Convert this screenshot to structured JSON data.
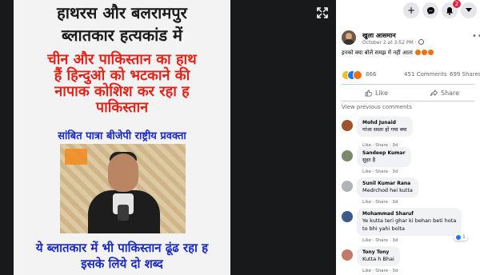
{
  "poster": {
    "title_line1": "हाथरस और बलरामपुर",
    "title_line2": "ब्लातकार हत्यकांड में",
    "red_line1": "चीन और पाकिस्तान का हाथ",
    "red_line2": "हैं हिन्दुओ को भटकाने की",
    "red_line3": "नापाक कोशिश कर रहा ह",
    "red_line4": "पाकिस्तान",
    "subtitle": "सांबित पात्रा बीजेपी राष्ट्रीय प्रवक्ता",
    "bottom_line1": "ये ब्लातकार में भी पाकिस्तान ढूंढ रहा ह",
    "bottom_line2": "इसके लिये दो शब्द"
  },
  "topbar": {
    "notification_count": "2"
  },
  "post": {
    "author": "खुला आसमान",
    "timestamp": "October 2 at 3:52 PM",
    "text": "इनको क्या बोलें समझ में नहीं आता",
    "reaction_count": "866",
    "comments_count": "451 Comments",
    "shares_count": "699 Shares",
    "like_label": "Like",
    "share_label": "Share",
    "view_previous": "View previous comments"
  },
  "comments": [
    {
      "name": "Mohd Junaid",
      "text": "गांजा सस्ता हो गया क्या",
      "meta": "Like · Share · 3d",
      "avatar_color": "#a0522d"
    },
    {
      "name": "Sandeep Kumar",
      "text": "सुहर है",
      "meta": "Like · Share · 3d",
      "avatar_color": "#7a8a6a"
    },
    {
      "name": "Sunil Kumar Rana",
      "text": "Medrchod hei kutta",
      "meta": "Like · Share · 3d",
      "avatar_color": "#b0b3b8"
    },
    {
      "name": "Mohammad Sharuf",
      "text": "Ye kutta teri ghar ki behan beti hota",
      "text2": "to bhi yahi bolta",
      "meta": "Like · Share · 3d",
      "avatar_color": "#3b5b8a",
      "likes": "1"
    },
    {
      "name": "Tony Tony",
      "text": "Kutta h Bhai",
      "meta": "Like · Share · 3d",
      "avatar_color": "#c07a6a"
    }
  ],
  "colors": {
    "accent_blue": "#1877f2",
    "red": "#e41e3f",
    "poster_red": "#e2231a",
    "poster_blue": "#1a2ac8"
  }
}
